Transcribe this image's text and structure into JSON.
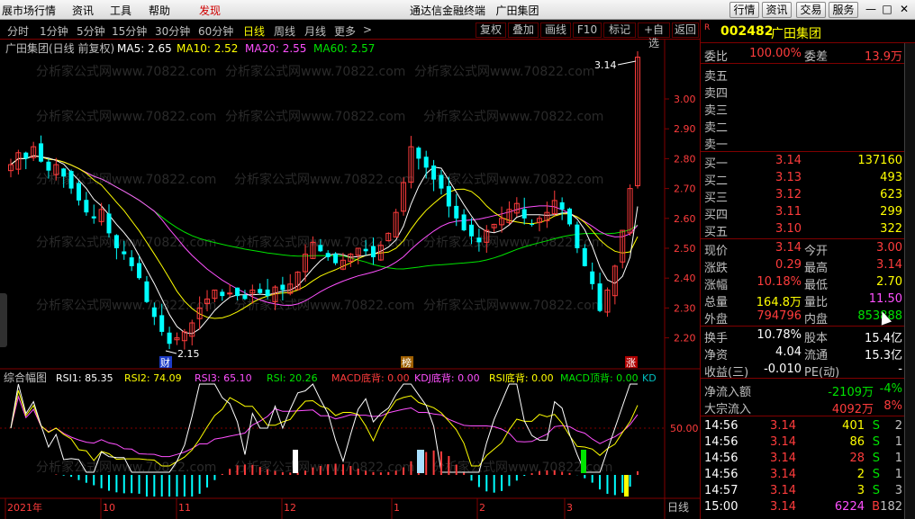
{
  "menu": {
    "items": [
      "展市场行情",
      "资讯",
      "工具",
      "帮助"
    ],
    "alert": "发现",
    "title": "通达信金融终端",
    "stock_title": "广田集团",
    "right_buttons": [
      "行情",
      "资讯",
      "交易",
      "服务"
    ]
  },
  "toolbar": {
    "timeframes": [
      "分时",
      "1分钟",
      "5分钟",
      "15分钟",
      "30分钟",
      "60分钟",
      "日线",
      "周线",
      "月线",
      "更多"
    ],
    "active_timeframe": "日线",
    "more_arrow": ">",
    "buttons": [
      "复权",
      "叠加",
      "画线",
      "F10",
      "标记",
      "+自选",
      "返回"
    ]
  },
  "main_chart": {
    "title": "广田集团(日线 前复权)",
    "indicators": [
      {
        "label": "MA5: 2.65",
        "color": "#ffffff"
      },
      {
        "label": "MA10: 2.52",
        "color": "#ffff00"
      },
      {
        "label": "MA20: 2.55",
        "color": "#ff50ff"
      },
      {
        "label": "MA60: 2.57",
        "color": "#00e400"
      }
    ],
    "price_axis": [
      "3.00",
      "2.90",
      "2.80",
      "2.70",
      "2.60",
      "2.50",
      "2.40",
      "2.30",
      "2.20"
    ],
    "high_marker": "3.14",
    "low_marker": "2.15",
    "markers": [
      "财",
      "榜",
      "涨"
    ],
    "watermark": "分析家公式网www.70822.com"
  },
  "sub_chart": {
    "title": "综合幅图",
    "indicators": [
      {
        "label": "RSI1: 85.35",
        "color": "#ffffff"
      },
      {
        "label": "RSI2: 74.09",
        "color": "#ffff00"
      },
      {
        "label": "RSI3: 65.10",
        "color": "#ff50ff"
      },
      {
        "label": "RSI: 20.26",
        "color": "#00e400"
      },
      {
        "label": "MACD底背: 0.00",
        "color": "#ff3c3c"
      },
      {
        "label": "KDJ底背: 0.00",
        "color": "#ff50ff"
      },
      {
        "label": "RSI底背: 0.00",
        "color": "#ffff00"
      },
      {
        "label": "MACD顶背: 0.00",
        "color": "#00e400"
      },
      {
        "label": "KD",
        "color": "#00c0c0"
      }
    ],
    "axis_label": "50.00"
  },
  "date_axis": {
    "labels": [
      "2021年",
      "10",
      "11",
      "12",
      "1",
      "2",
      "3"
    ],
    "period": "日线"
  },
  "quote": {
    "code": "002482",
    "name": "广田集团",
    "r_badge": "R",
    "weibi": {
      "label": "委比",
      "value": "100.00%",
      "label2": "委差",
      "value2": "13.9万"
    },
    "sell": [
      {
        "label": "卖五",
        "price": "",
        "volume": ""
      },
      {
        "label": "卖四",
        "price": "",
        "volume": ""
      },
      {
        "label": "卖三",
        "price": "",
        "volume": ""
      },
      {
        "label": "卖二",
        "price": "",
        "volume": ""
      },
      {
        "label": "卖一",
        "price": "",
        "volume": ""
      }
    ],
    "buy": [
      {
        "label": "买一",
        "price": "3.14",
        "volume": "137160"
      },
      {
        "label": "买二",
        "price": "3.13",
        "volume": "493"
      },
      {
        "label": "买三",
        "price": "3.12",
        "volume": "623"
      },
      {
        "label": "买四",
        "price": "3.11",
        "volume": "299"
      },
      {
        "label": "买五",
        "price": "3.10",
        "volume": "322"
      }
    ],
    "stats": [
      {
        "l1": "现价",
        "v1": "3.14",
        "c1": "up",
        "l2": "今开",
        "v2": "3.00",
        "c2": "up"
      },
      {
        "l1": "涨跌",
        "v1": "0.29",
        "c1": "up",
        "l2": "最高",
        "v2": "3.14",
        "c2": "up"
      },
      {
        "l1": "涨幅",
        "v1": "10.18%",
        "c1": "up",
        "l2": "最低",
        "v2": "2.70",
        "c2": "yellow"
      },
      {
        "l1": "总量",
        "v1": "164.8万",
        "c1": "yellow",
        "l2": "量比",
        "v2": "11.50",
        "c2": "magenta"
      },
      {
        "l1": "外盘",
        "v1": "794796",
        "c1": "up",
        "l2": "内盘",
        "v2": "853888",
        "c2": "green"
      }
    ],
    "stats2": [
      {
        "l1": "换手",
        "v1": "10.78%",
        "c1": "white",
        "l2": "股本",
        "v2": "15.4亿",
        "c2": "white"
      },
      {
        "l1": "净资",
        "v1": "4.04",
        "c1": "white",
        "l2": "流通",
        "v2": "15.3亿",
        "c2": "white"
      },
      {
        "l1": "收益(三)",
        "v1": "-0.010",
        "c1": "white",
        "l2": "PE(动)",
        "v2": "-",
        "c2": "white"
      }
    ],
    "flows": [
      {
        "label": "净流入额",
        "value": "-2109万",
        "vclass": "green",
        "pct": "-4%",
        "pclass": "green"
      },
      {
        "label": "大宗流入",
        "value": "4092万",
        "vclass": "up",
        "pct": "8%",
        "pclass": "up"
      }
    ],
    "ticks": [
      {
        "time": "14:56",
        "price": "3.14",
        "vol": "401",
        "side": "S",
        "n": "2",
        "volclass": "yellow"
      },
      {
        "time": "14:56",
        "price": "3.14",
        "vol": "86",
        "side": "S",
        "n": "1",
        "volclass": "yellow"
      },
      {
        "time": "14:56",
        "price": "3.14",
        "vol": "28",
        "side": "S",
        "n": "1",
        "volclass": "up"
      },
      {
        "time": "14:56",
        "price": "3.14",
        "vol": "2",
        "side": "S",
        "n": "1",
        "volclass": "yellow"
      },
      {
        "time": "14:57",
        "price": "3.14",
        "vol": "3",
        "side": "S",
        "n": "3",
        "volclass": "yellow"
      },
      {
        "time": "15:00",
        "price": "3.14",
        "vol": "6224",
        "side": "B",
        "n": "182",
        "volclass": "magenta"
      }
    ]
  },
  "colors": {
    "up": "#ff3c3c",
    "down": "#00ffff",
    "frame": "#800000",
    "ma5": "#ffffff",
    "ma10": "#ffff00",
    "ma20": "#ff50ff",
    "ma60": "#00e400"
  }
}
